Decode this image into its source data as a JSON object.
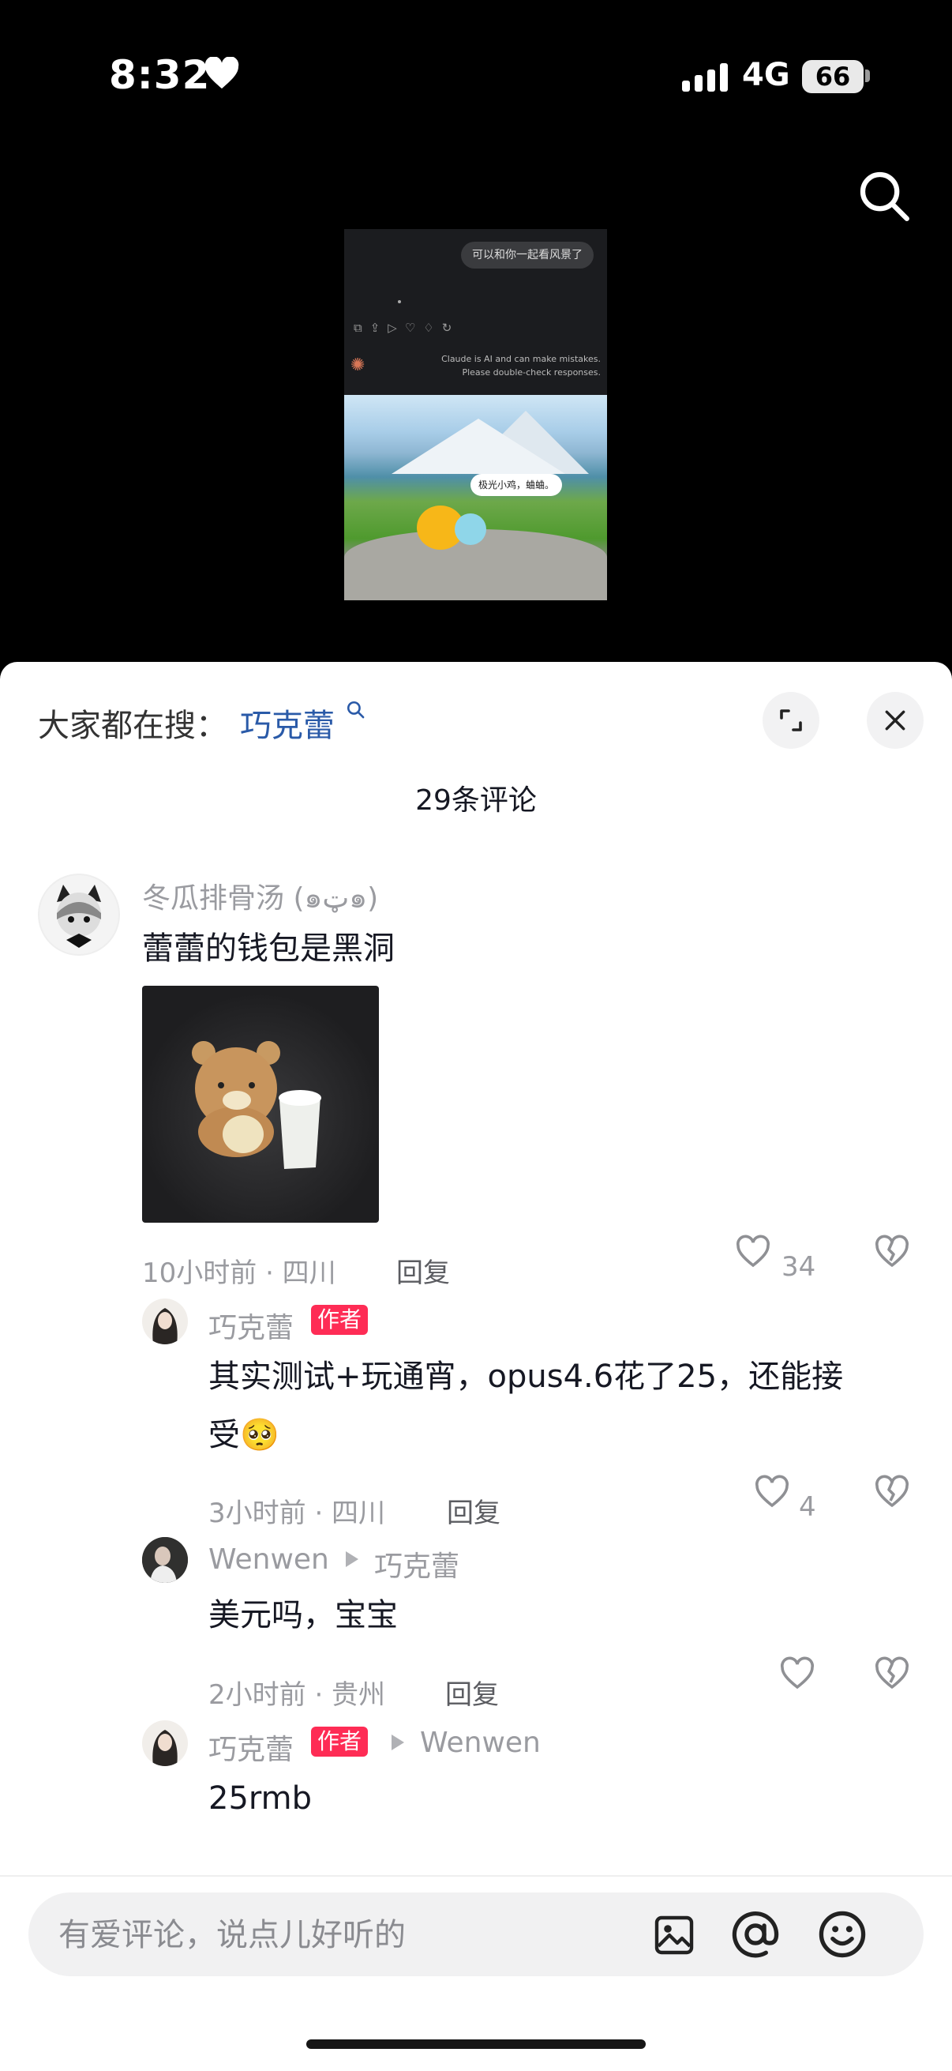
{
  "status_bar": {
    "time": "8:32",
    "network": "4G",
    "battery": "66"
  },
  "video": {
    "chat_message": "可以和你一起看风景了",
    "disclaimer_line1": "Claude is AI and can make mistakes.",
    "disclaimer_line2": "Please double-check responses.",
    "scene_caption": "极光小鸡，蛐蛐。"
  },
  "sheet": {
    "hot_search_prefix": "大家都在搜：",
    "hot_search_term": "巧克蕾",
    "comment_count": "29条评论",
    "input_placeholder": "有爱评论，说点儿好听的"
  },
  "comments": [
    {
      "user": "冬瓜排骨汤 (๑ټ๑)",
      "text": "蕾蕾的钱包是黑洞",
      "time_location": "10小时前 · 四川",
      "reply_label": "回复",
      "likes": "34"
    },
    {
      "user": "巧克蕾",
      "tag": "作者",
      "text_line1": "其实测试+玩通宵，opus4.6花了25，还能接",
      "text_line2": "受🥺",
      "time_location": "3小时前 · 四川",
      "reply_label": "回复",
      "likes": "4"
    },
    {
      "user": "Wenwen",
      "reply_to": "巧克蕾",
      "text": "美元吗，宝宝",
      "time_location": "2小时前 · 贵州",
      "reply_label": "回复"
    },
    {
      "user": "巧克蕾",
      "tag": "作者",
      "reply_to": "Wenwen",
      "text": "25rmb"
    }
  ],
  "icons": {
    "status_heart": "heart-icon",
    "search": "search-icon",
    "expand": "expand-icon",
    "close": "close-icon",
    "like": "heart-outline-icon",
    "dislike": "broken-heart-icon",
    "image": "image-icon",
    "mention": "at-icon",
    "emoji": "smile-icon"
  },
  "colors": {
    "accent": "#fe2c55",
    "link": "#2a5aa8"
  }
}
